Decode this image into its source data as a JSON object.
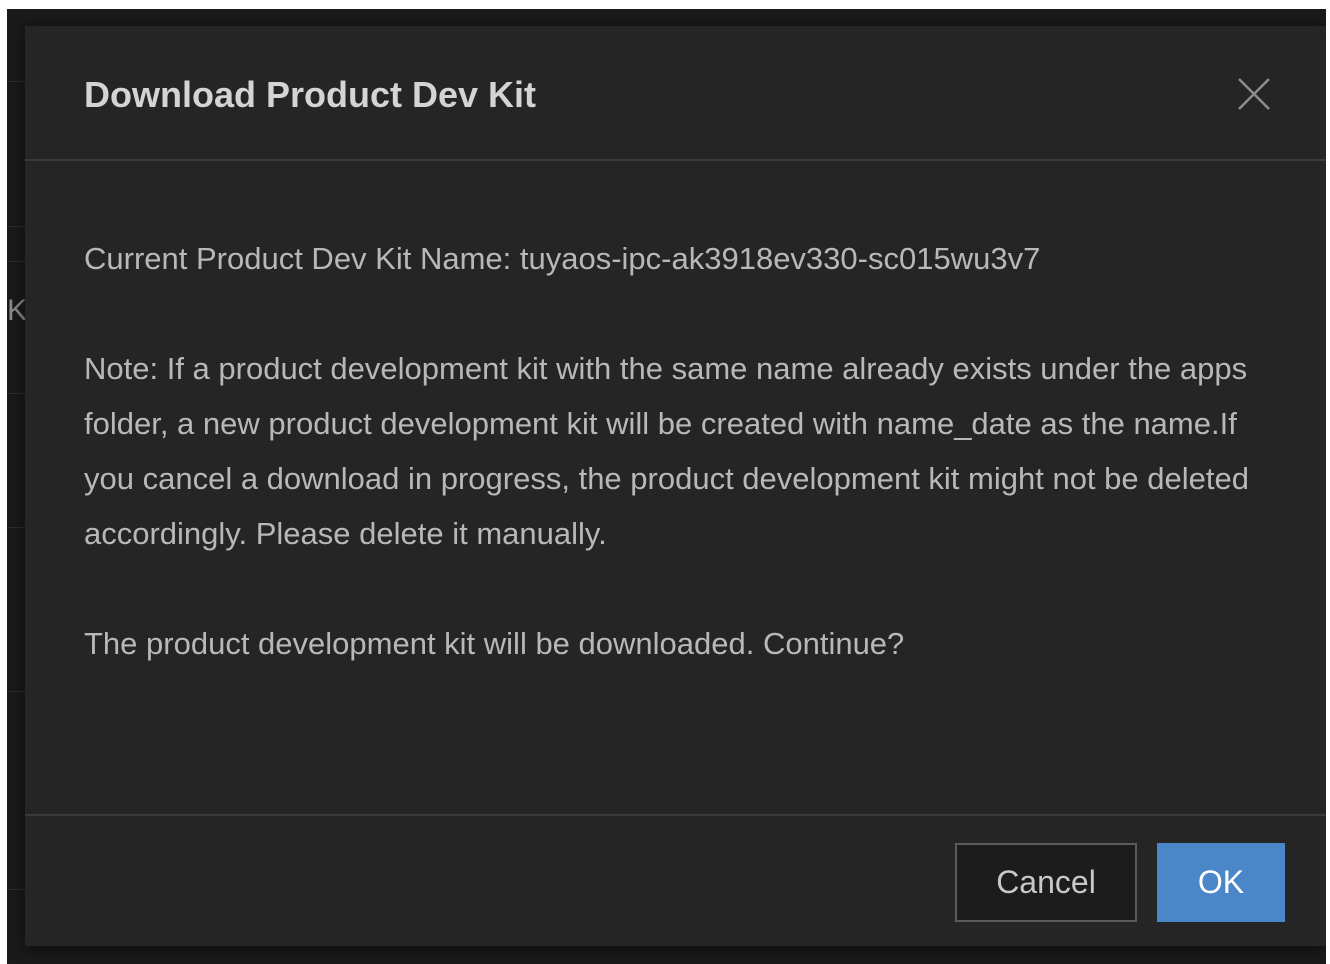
{
  "background": {
    "edge_text": "K"
  },
  "dialog": {
    "title": "Download Product Dev Kit",
    "close_icon": "close-icon",
    "kit_name_line": "Current Product Dev Kit Name: tuyaos-ipc-ak3918ev330-sc015wu3v7",
    "note": "Note: If a product development kit with the same name already exists under the apps folder, a new product development kit will be created with name_date as the name.If you cancel a download in progress, the product development kit might not be deleted accordingly. Please delete it manually.",
    "confirm": "The product development kit will be downloaded. Continue?",
    "buttons": {
      "cancel_label": "Cancel",
      "ok_label": "OK"
    }
  },
  "colors": {
    "dialog_background": "#252526",
    "primary_button": "#4a86c8",
    "text": "#b8b8b8",
    "title": "#d4d4d4"
  }
}
